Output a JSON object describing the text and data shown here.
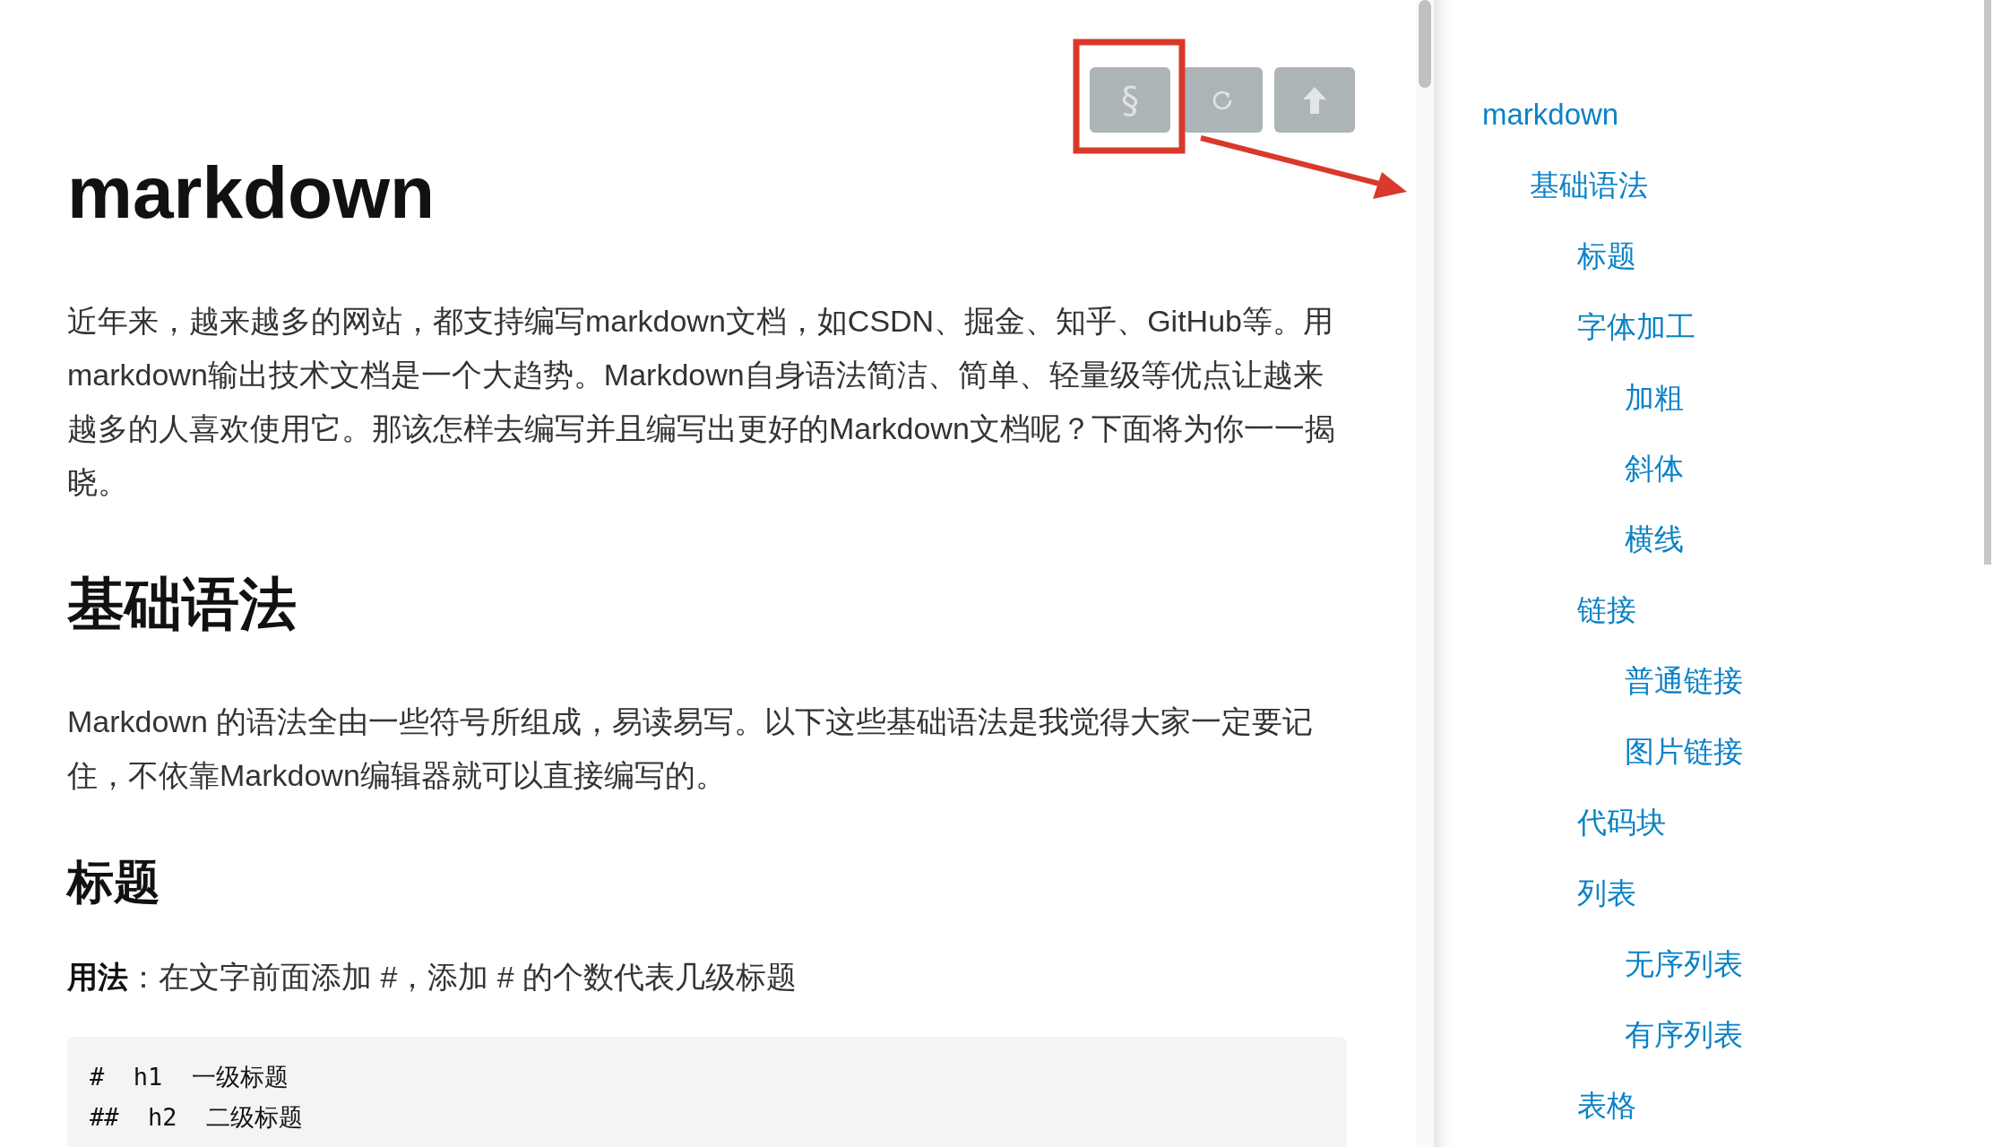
{
  "toolbar": [
    {
      "kind": "section",
      "label": "§"
    },
    {
      "kind": "refresh"
    },
    {
      "kind": "top"
    }
  ],
  "article": {
    "title": "markdown",
    "intro": "近年来，越来越多的网站，都支持编写markdown文档，如CSDN、掘金、知乎、GitHub等。用markdown输出技术文档是一个大趋势。Markdown自身语法简洁、简单、轻量级等优点让越来越多的人喜欢使用它。那该怎样去编写并且编写出更好的Markdown文档呢？下面将为你一一揭晓。",
    "section_title": "基础语法",
    "section_text": "Markdown 的语法全由一些符号所组成，易读易写。以下这些基础语法是我觉得大家一定要记住，不依靠Markdown编辑器就可以直接编写的。",
    "subsection_title": "标题",
    "usage": "**用法**：在文字前面添加 #，添加 # 的个数代表几级标题",
    "code_lines": [
      "#  h1  一级标题",
      "##  h2  二级标题"
    ]
  },
  "toc": [
    {
      "label": "markdown",
      "children": [
        {
          "label": "基础语法",
          "children": [
            {
              "label": "标题"
            },
            {
              "label": "字体加工",
              "children": [
                {
                  "label": "加粗"
                },
                {
                  "label": "斜体"
                },
                {
                  "label": "横线"
                }
              ]
            },
            {
              "label": "链接",
              "children": [
                {
                  "label": "普通链接"
                },
                {
                  "label": "图片链接"
                }
              ]
            },
            {
              "label": "代码块"
            },
            {
              "label": "列表",
              "children": [
                {
                  "label": "无序列表"
                },
                {
                  "label": "有序列表"
                }
              ]
            },
            {
              "label": "表格"
            }
          ]
        }
      ]
    }
  ]
}
